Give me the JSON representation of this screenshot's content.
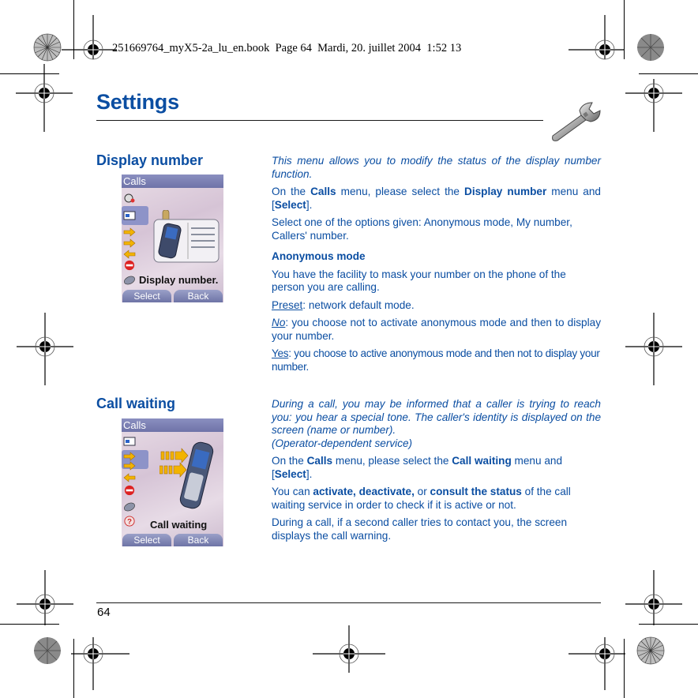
{
  "book_header": "251669764_myX5-2a_lu_en.book  Page 64  Mardi, 20. juillet 2004  1:52 13",
  "page": {
    "title": "Settings",
    "title_icon": "wrench-icon",
    "page_number": "64",
    "text_color": "#0b4ea2"
  },
  "sections": [
    {
      "heading": "Display number",
      "phone_screen": {
        "header": "Calls",
        "caption": "Display number.",
        "softkey_left": "Select",
        "softkey_right": "Back",
        "menu_icons": [
          "alarm-icon",
          "id-card-icon",
          "forward-calls-icon",
          "incoming-call-icon",
          "barred-icon",
          "pebble-icon"
        ]
      },
      "intro": "This menu allows you to modify the status of the display number function.",
      "nav": {
        "p1": "On the ",
        "b1": "Calls",
        "p2": " menu, please select the ",
        "b2": "Display number",
        "p3": " menu and [",
        "b3": "Select",
        "p4": "]."
      },
      "options_text": "Select one of the options given: Anonymous mode, My number, Callers' number.",
      "subheading": "Anonymous mode",
      "sub_text": "You have the facility to mask your number on the phone of the person you are calling.",
      "options": [
        {
          "label": "Preset",
          "text": ": network default mode.",
          "italic": false
        },
        {
          "label": "No",
          "text": ": you choose not to activate anonymous mode and then to display your number.",
          "italic": true
        },
        {
          "label": "Yes",
          "text": ": you choose to active anonymous mode and then not to display your number.",
          "italic": false
        }
      ]
    },
    {
      "heading": "Call waiting",
      "phone_screen": {
        "header": "Calls",
        "caption": "Call waiting",
        "softkey_left": "Select",
        "softkey_right": "Back",
        "menu_icons": [
          "id-card-icon",
          "forward-calls-icon",
          "incoming-call-icon",
          "barred-icon",
          "pebble-icon",
          "help-icon"
        ]
      },
      "intro_lines": [
        "During a call, you may be informed that a caller is trying to reach you: you hear a special tone. The caller's identity is displayed on the screen (name or number).",
        "(Operator-dependent service)"
      ],
      "nav": {
        "p1": "On the ",
        "b1": "Calls",
        "p2": " menu, please select the ",
        "b2": "Call waiting",
        "p3": " menu and [",
        "b3": "Select",
        "p4": "]."
      },
      "actions": {
        "p1": "You can ",
        "b1": "activate, deactivate,",
        "p2": " or ",
        "b2": "consult the status",
        "p3": " of the call waiting service in order to check if it is active or not."
      },
      "warning_text": "During a call, if a second caller tries to contact you, the screen displays the call warning."
    }
  ]
}
